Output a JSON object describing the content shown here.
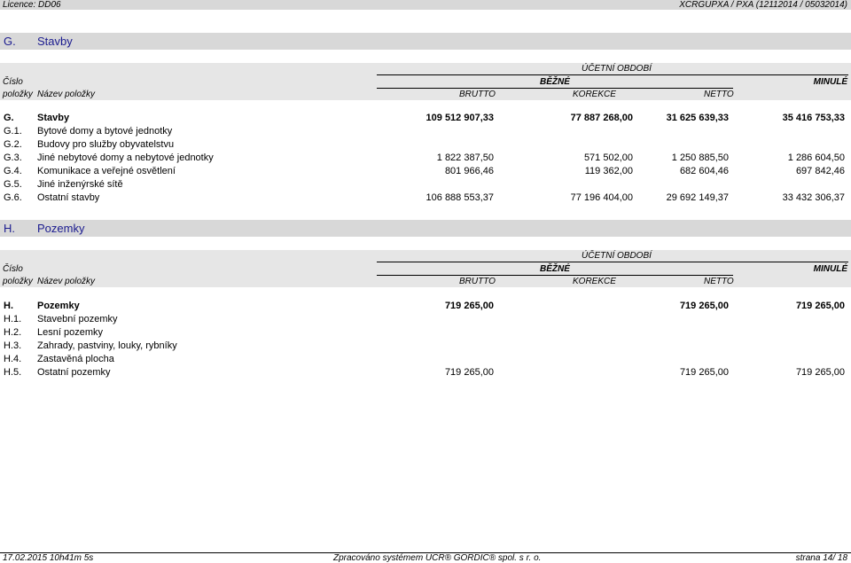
{
  "header": {
    "licence": "Licence: DD06",
    "version": "XCRGUPXA / PXA   (12112014 / 05032014)"
  },
  "columns": {
    "period": "ÚČETNÍ OBDOBÍ",
    "cislo": "Číslo",
    "polozky": "položky",
    "nazev": "Název položky",
    "bezne": "BĚŽNÉ",
    "minule": "MINULÉ",
    "brutto": "BRUTTO",
    "korekce": "KOREKCE",
    "netto": "NETTO"
  },
  "sections": [
    {
      "code": "G.",
      "title": "Stavby",
      "rows": [
        {
          "code": "G.",
          "name": "Stavby",
          "brutto": "109 512 907,33",
          "korekce": "77 887 268,00",
          "netto": "31 625 639,33",
          "minule": "35 416 753,33",
          "bold": true
        },
        {
          "code": "G.1.",
          "name": "Bytové domy a bytové jednotky",
          "brutto": "",
          "korekce": "",
          "netto": "",
          "minule": ""
        },
        {
          "code": "G.2.",
          "name": "Budovy pro služby obyvatelstvu",
          "brutto": "",
          "korekce": "",
          "netto": "",
          "minule": ""
        },
        {
          "code": "G.3.",
          "name": "Jiné nebytové domy a nebytové jednotky",
          "brutto": "1 822 387,50",
          "korekce": "571 502,00",
          "netto": "1 250 885,50",
          "minule": "1 286 604,50"
        },
        {
          "code": "G.4.",
          "name": "Komunikace a veřejné osvětlení",
          "brutto": "801 966,46",
          "korekce": "119 362,00",
          "netto": "682 604,46",
          "minule": "697 842,46"
        },
        {
          "code": "G.5.",
          "name": "Jiné inženýrské sítě",
          "brutto": "",
          "korekce": "",
          "netto": "",
          "minule": ""
        },
        {
          "code": "G.6.",
          "name": "Ostatní stavby",
          "brutto": "106 888 553,37",
          "korekce": "77 196 404,00",
          "netto": "29 692 149,37",
          "minule": "33 432 306,37"
        }
      ]
    },
    {
      "code": "H.",
      "title": "Pozemky",
      "rows": [
        {
          "code": "H.",
          "name": "Pozemky",
          "brutto": "719 265,00",
          "korekce": "",
          "netto": "719 265,00",
          "minule": "719 265,00",
          "bold": true
        },
        {
          "code": "H.1.",
          "name": "Stavební pozemky",
          "brutto": "",
          "korekce": "",
          "netto": "",
          "minule": ""
        },
        {
          "code": "H.2.",
          "name": "Lesní pozemky",
          "brutto": "",
          "korekce": "",
          "netto": "",
          "minule": ""
        },
        {
          "code": "H.3.",
          "name": "Zahrady, pastviny, louky, rybníky",
          "brutto": "",
          "korekce": "",
          "netto": "",
          "minule": ""
        },
        {
          "code": "H.4.",
          "name": "Zastavěná plocha",
          "brutto": "",
          "korekce": "",
          "netto": "",
          "minule": ""
        },
        {
          "code": "H.5.",
          "name": "Ostatní pozemky",
          "brutto": "719 265,00",
          "korekce": "",
          "netto": "719 265,00",
          "minule": "719 265,00"
        }
      ]
    }
  ],
  "footer": {
    "date": "17.02.2015 10h41m 5s",
    "processed": "Zpracováno systémem   UCR® GORDIC® spol. s   r. o.",
    "page": "strana  14/ 18"
  }
}
